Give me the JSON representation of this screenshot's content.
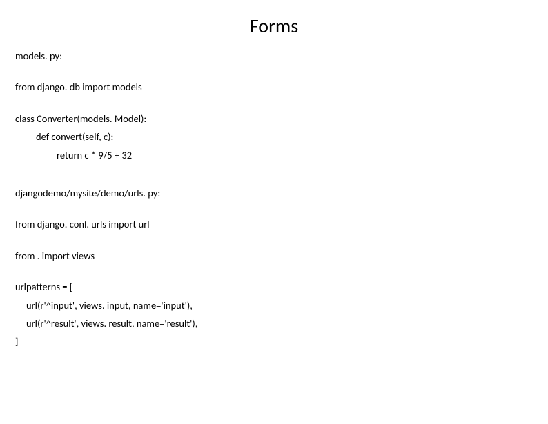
{
  "title": "Forms",
  "section1": {
    "header": "models. py:",
    "line1": "from django. db import models",
    "line2": "class Converter(models. Model):",
    "line3": "def convert(self, c):",
    "line4": "return c * 9/5 + 32"
  },
  "section2": {
    "header": "djangodemo/mysite/demo/urls. py:",
    "line1": "from django. conf. urls import url",
    "line2": "from . import views",
    "line3": "urlpatterns = [",
    "line4": "url(r'^input', views. input, name='input'),",
    "line5": "url(r'^result', views. result, name='result'),",
    "line6": "]"
  }
}
